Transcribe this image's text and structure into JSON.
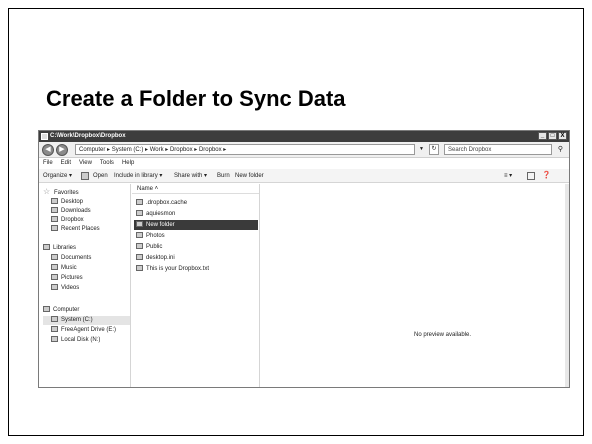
{
  "slide": {
    "title": "Create a Folder to Sync Data"
  },
  "window": {
    "title": "C:\\Work\\Dropbox\\Dropbox",
    "controls": [
      "_",
      "□",
      "X"
    ],
    "address": "Computer ▸ System (C:) ▸ Work ▸ Dropbox ▸ Dropbox ▸",
    "search_placeholder": "Search Dropbox",
    "menu": [
      "File",
      "Edit",
      "View",
      "Tools",
      "Help"
    ],
    "toolbar": {
      "organize": "Organize ▾",
      "open": "Open",
      "include": "Include in library ▾",
      "share": "Share with ▾",
      "burn": "Burn",
      "new_folder": "New folder"
    },
    "nav": {
      "favorites": "Favorites",
      "fav_items": [
        "Desktop",
        "Downloads",
        "Dropbox",
        "Recent Places"
      ],
      "libraries": "Libraries",
      "lib_items": [
        "Documents",
        "Music",
        "Pictures",
        "Videos"
      ],
      "computer": "Computer",
      "comp_items": [
        "System (C:)",
        "FreeAgent Drive (E:)",
        "Local Disk (N:)"
      ]
    },
    "files": {
      "column": "Name ˄",
      "items": [
        ".dropbox.cache",
        "aquiesmon",
        "New folder",
        "Photos",
        "Public",
        "desktop.ini",
        "This is your Dropbox.txt"
      ]
    },
    "preview": "No preview available."
  }
}
